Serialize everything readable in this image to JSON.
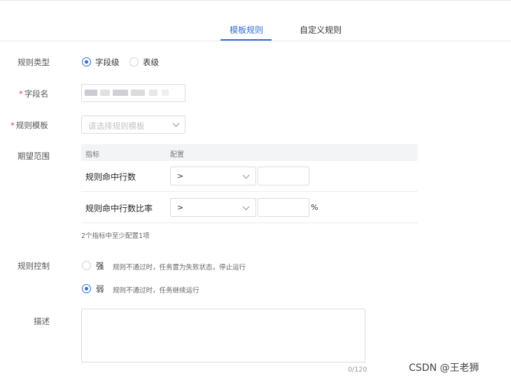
{
  "tabs": [
    {
      "label": "模板规则",
      "active": true
    },
    {
      "label": "自定义规则",
      "active": false
    }
  ],
  "form": {
    "rule_type": {
      "label": "规则类型",
      "options": [
        {
          "label": "字段级",
          "checked": true
        },
        {
          "label": "表级",
          "checked": false
        }
      ]
    },
    "field_name": {
      "label": "字段名",
      "required": true
    },
    "rule_template": {
      "label": "规则模板",
      "required": true,
      "placeholder": "请选择规则模板"
    },
    "expected_range": {
      "label": "期望范围",
      "header": {
        "metric": "指标",
        "config": "配置"
      },
      "rows": [
        {
          "name": "规则命中行数",
          "operator": ">",
          "value": "",
          "unit": ""
        },
        {
          "name": "规则命中行数比率",
          "operator": ">",
          "value": "",
          "unit": "%"
        }
      ],
      "hint": "2个指标中至少配置1项"
    },
    "rule_control": {
      "label": "规则控制",
      "options": [
        {
          "label": "强",
          "desc": "规则不通过时，任务置为失败状态，停止运行",
          "checked": false
        },
        {
          "label": "弱",
          "desc": "规则不通过时，任务继续运行",
          "checked": true
        }
      ]
    },
    "description": {
      "label": "描述",
      "value": "",
      "counter": "0/120"
    }
  },
  "watermark": "CSDN @王老狮",
  "colors": {
    "accent": "#2f6fd6",
    "required": "#e5484d",
    "border": "#d9dce1"
  }
}
